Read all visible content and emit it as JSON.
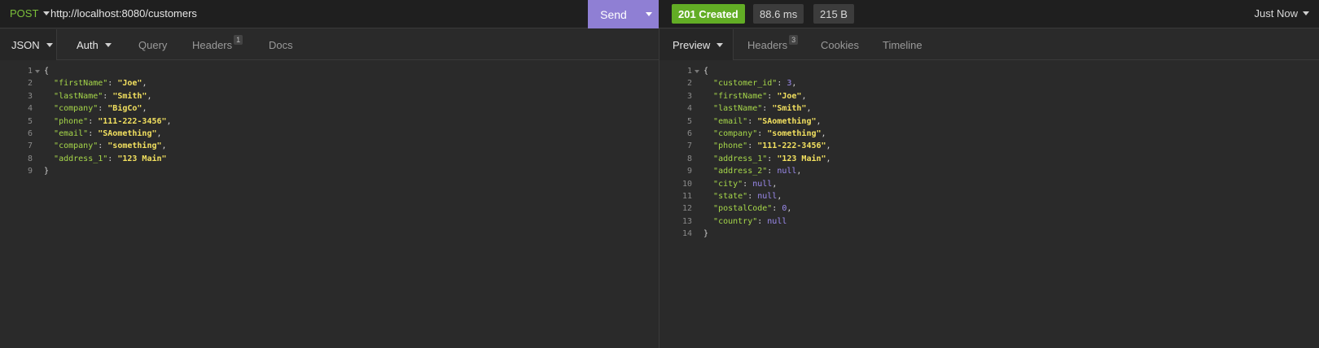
{
  "request": {
    "method": "POST",
    "url": "http://localhost:8080/customers",
    "send_label": "Send",
    "tabs": [
      {
        "label": "JSON"
      },
      {
        "label": "Auth"
      },
      {
        "label": "Query"
      },
      {
        "label": "Headers",
        "count": "1"
      },
      {
        "label": "Docs"
      }
    ],
    "body": [
      {
        "ln": "1",
        "text": "{"
      },
      {
        "ln": "2",
        "key": "\"firstName\"",
        "val": "\"Joe\"",
        "vtype": "string",
        "comma": ","
      },
      {
        "ln": "3",
        "key": "\"lastName\"",
        "val": "\"Smith\"",
        "vtype": "string",
        "comma": ","
      },
      {
        "ln": "4",
        "key": "\"company\"",
        "val": "\"BigCo\"",
        "vtype": "string",
        "comma": ","
      },
      {
        "ln": "5",
        "key": "\"phone\"",
        "val": "\"111-222-3456\"",
        "vtype": "string",
        "comma": ","
      },
      {
        "ln": "6",
        "key": "\"email\"",
        "val": "\"SAomething\"",
        "vtype": "string",
        "comma": ","
      },
      {
        "ln": "7",
        "key": "\"company\"",
        "val": "\"something\"",
        "vtype": "string",
        "comma": ","
      },
      {
        "ln": "8",
        "key": "\"address_1\"",
        "val": "\"123 Main\"",
        "vtype": "string",
        "comma": ""
      },
      {
        "ln": "9",
        "text": "}"
      }
    ]
  },
  "response": {
    "status": "201 Created",
    "time": "88.6 ms",
    "size": "215 B",
    "history": "Just Now",
    "tabs": [
      {
        "label": "Preview"
      },
      {
        "label": "Headers",
        "count": "3"
      },
      {
        "label": "Cookies"
      },
      {
        "label": "Timeline"
      }
    ],
    "body": [
      {
        "ln": "1",
        "text": "{"
      },
      {
        "ln": "2",
        "key": "\"customer_id\"",
        "val": "3",
        "vtype": "number",
        "comma": ","
      },
      {
        "ln": "3",
        "key": "\"firstName\"",
        "val": "\"Joe\"",
        "vtype": "string",
        "comma": ","
      },
      {
        "ln": "4",
        "key": "\"lastName\"",
        "val": "\"Smith\"",
        "vtype": "string",
        "comma": ","
      },
      {
        "ln": "5",
        "key": "\"email\"",
        "val": "\"SAomething\"",
        "vtype": "string",
        "comma": ","
      },
      {
        "ln": "6",
        "key": "\"company\"",
        "val": "\"something\"",
        "vtype": "string",
        "comma": ","
      },
      {
        "ln": "7",
        "key": "\"phone\"",
        "val": "\"111-222-3456\"",
        "vtype": "string",
        "comma": ","
      },
      {
        "ln": "8",
        "key": "\"address_1\"",
        "val": "\"123 Main\"",
        "vtype": "string",
        "comma": ","
      },
      {
        "ln": "9",
        "key": "\"address_2\"",
        "val": "null",
        "vtype": "number",
        "comma": ","
      },
      {
        "ln": "10",
        "key": "\"city\"",
        "val": "null",
        "vtype": "number",
        "comma": ","
      },
      {
        "ln": "11",
        "key": "\"state\"",
        "val": "null",
        "vtype": "number",
        "comma": ","
      },
      {
        "ln": "12",
        "key": "\"postalCode\"",
        "val": "0",
        "vtype": "number",
        "comma": ","
      },
      {
        "ln": "13",
        "key": "\"country\"",
        "val": "null",
        "vtype": "number",
        "comma": ""
      },
      {
        "ln": "14",
        "text": "}"
      }
    ]
  },
  "colors": {
    "method": "#7bbf3a",
    "send_button": "#8f7fd4",
    "status_success": "#62ad25",
    "json_key": "#a6d74a",
    "json_string": "#f2e05f",
    "json_literal": "#9d8cf0"
  }
}
